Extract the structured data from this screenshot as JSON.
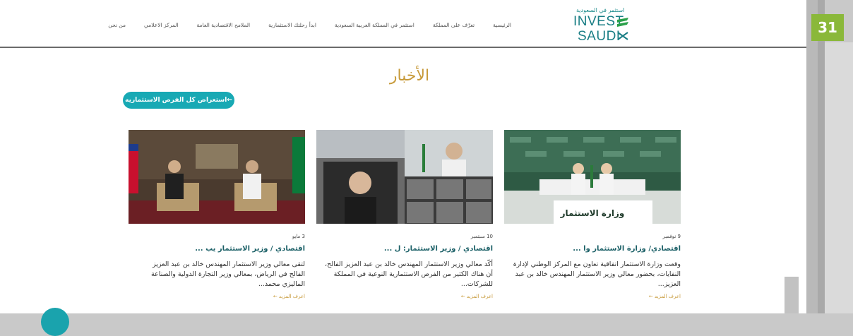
{
  "page_badge": "31",
  "header": {
    "nav": [
      "الرئيسية",
      "تعرّف على المملكة",
      "استثمر في المملكة العربية السعودية",
      "ابدأ رحلتك الاستثمارية",
      "الملامح الاقتصادية العامة",
      "المركز الاعلامي",
      "من نحن"
    ],
    "logo_arabic": "استثمر في السعودية",
    "logo_line1": "INVEST",
    "logo_line2": "SAUDI"
  },
  "main": {
    "title": "الأخبار",
    "cta_label": "استعراض كل الفرص الاستثماريه←"
  },
  "cards": [
    {
      "date": "9 نوفمبر",
      "title": "اقتصادي/ وزارة الاستثمار وا ...",
      "body": "وقعت وزارة الاستثمار اتفاقية تعاون مع المركز الوطني لإدارة النفايات، بحضور معالي وزير الاستثمار المهندس خالد بن عبد العزيز...",
      "more": "اعرف المزيد ←",
      "image_sign": "وزارة الاستثمار"
    },
    {
      "date": "10 سبتمبر",
      "title": "اقتصادي / وزير الاستثمار: ل ...",
      "body": "أكّد معالي وزير الاستثمار المهندس خالد بن عبد العزيز الفالح، أن هناك الكثير من الفرص الاستثمارية النوعية في المملكة للشركات...",
      "more": "اعرف المزيد ←"
    },
    {
      "date": "3 مايو",
      "title": "اقتصادي / وزير الاستثمار يب ...",
      "body": "لتقى معالي وزير الاستثمار المهندس خالد بن عبد العزيز الفالح في الرياض، بمعالي وزير التجارة الدولية والصناعة الماليزي محمد...",
      "more": "اعرف المزيد ←"
    }
  ],
  "colors": {
    "teal": "#18a9b4",
    "gold": "#c79a3a",
    "badge": "#8ab83a"
  }
}
